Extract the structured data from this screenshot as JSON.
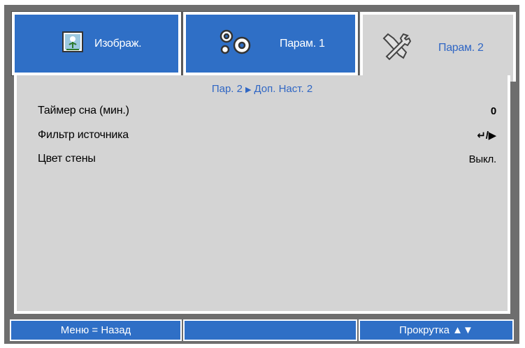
{
  "tabs": [
    {
      "label": "Изображ.",
      "icon": "image-icon",
      "active": false
    },
    {
      "label": "Парам. 1",
      "icon": "gears-icon",
      "active": false
    },
    {
      "label": "Парам. 2",
      "icon": "tools-icon",
      "active": true
    }
  ],
  "breadcrumb": {
    "parent": "Пар. 2",
    "current": "Доп. Наст. 2"
  },
  "settings": [
    {
      "label": "Таймер сна (мин.)",
      "value": "0"
    },
    {
      "label": "Фильтр источника",
      "value": "↵/▶"
    },
    {
      "label": "Цвет стены",
      "value": "Выкл."
    }
  ],
  "footer": {
    "left": "Меню = Назад",
    "middle": "",
    "right": "Прокрутка ▲▼"
  },
  "colors": {
    "tab_blue": "#2f6fc6",
    "panel_gray": "#d4d4d4",
    "frame_gray": "#6e6e6e",
    "accent_text": "#2f66c4"
  }
}
